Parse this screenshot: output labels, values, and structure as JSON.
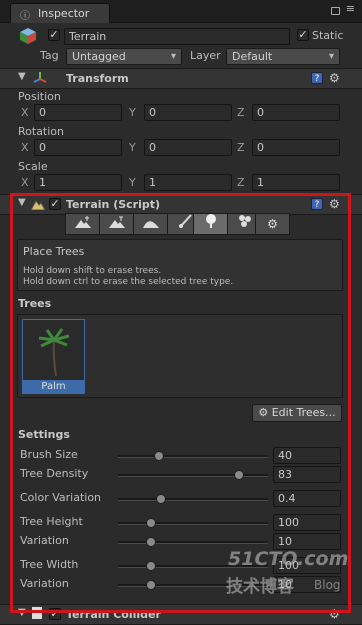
{
  "tab": {
    "title": "Inspector"
  },
  "object": {
    "name": "Terrain",
    "static_label": "Static",
    "tag_label": "Tag",
    "tag_value": "Untagged",
    "layer_label": "Layer",
    "layer_value": "Default"
  },
  "transform": {
    "title": "Transform",
    "position": {
      "label": "Position",
      "x": "0",
      "y": "0",
      "z": "0"
    },
    "rotation": {
      "label": "Rotation",
      "x": "0",
      "y": "0",
      "z": "0"
    },
    "scale": {
      "label": "Scale",
      "x": "1",
      "y": "1",
      "z": "1"
    },
    "axes": {
      "x": "X",
      "y": "Y",
      "z": "Z"
    }
  },
  "terrain": {
    "title": "Terrain (Script)",
    "tools": [
      "raise-lower-tool",
      "paint-height-tool",
      "smooth-height-tool",
      "paint-texture-tool",
      "place-trees-tool",
      "paint-details-tool",
      "settings-tool"
    ],
    "help_title": "Place Trees",
    "help_line1": "Hold down shift to erase trees.",
    "help_line2": "Hold down ctrl to erase the selected tree type.",
    "trees_label": "Trees",
    "tree_item": "Palm",
    "edit_trees_label": "Edit Trees...",
    "settings_label": "Settings",
    "sliders": [
      {
        "label": "Brush Size",
        "value": "40",
        "fraction": 0.26
      },
      {
        "label": "Tree Density",
        "value": "83",
        "fraction": 0.83
      },
      {
        "label": "Color Variation",
        "value": "0.4",
        "fraction": 0.27
      },
      {
        "label": "Tree Height",
        "value": "100",
        "fraction": 0.2
      },
      {
        "label": "Variation",
        "value": "10",
        "fraction": 0.2
      },
      {
        "label": "Tree Width",
        "value": "100",
        "fraction": 0.2
      },
      {
        "label": "Variation",
        "value": "10",
        "fraction": 0.2
      }
    ]
  },
  "next_component": {
    "title": "Terrain Collider"
  },
  "watermark": {
    "main": "51CTO.com",
    "sub": "技术博客",
    "blog": "Blog"
  },
  "colors": {
    "highlight": "#d0141b",
    "selection": "#3d6aa8"
  }
}
